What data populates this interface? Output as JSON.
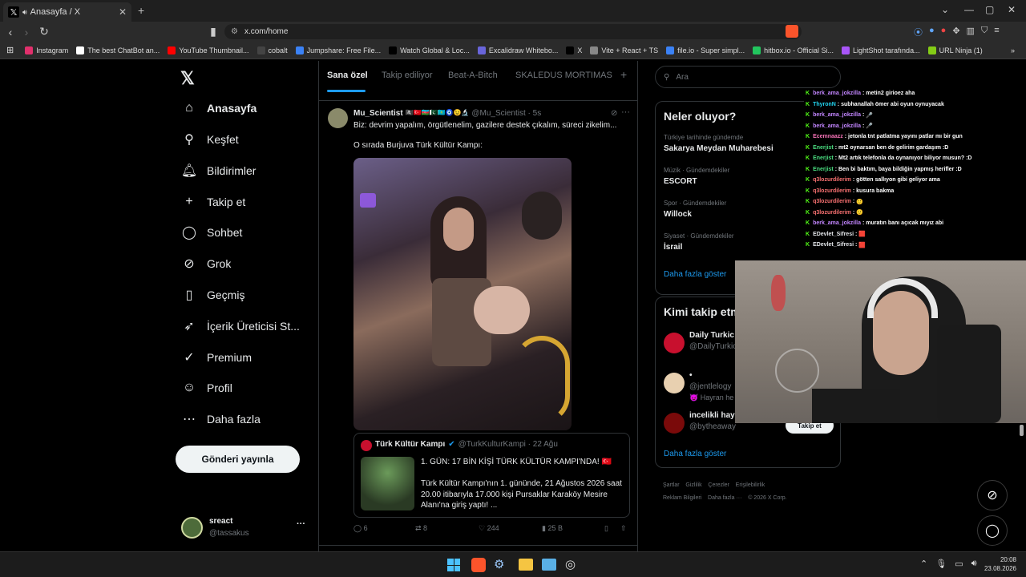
{
  "browser": {
    "tab_title": "Anasayfa / X",
    "url": "x.com/home",
    "bookmarks": [
      {
        "label": "Instagram",
        "color": "#e1306c"
      },
      {
        "label": "The best ChatBot an...",
        "color": "#ffffff"
      },
      {
        "label": "YouTube Thumbnail...",
        "color": "#ff0000"
      },
      {
        "label": "cobalt",
        "color": "#444444"
      },
      {
        "label": "Jumpshare: Free File...",
        "color": "#3b82f6"
      },
      {
        "label": "Watch Global & Loc...",
        "color": "#000000"
      },
      {
        "label": "Excalidraw Whitebo...",
        "color": "#6965db"
      },
      {
        "label": "X",
        "color": "#000000"
      },
      {
        "label": "Vite + React + TS",
        "color": "#888888"
      },
      {
        "label": "file.io - Super simpl...",
        "color": "#3b82f6"
      },
      {
        "label": "hitbox.io - Official Si...",
        "color": "#22c55e"
      },
      {
        "label": "LightShot tarafında...",
        "color": "#a855f7"
      },
      {
        "label": "URL Ninja (1)",
        "color": "#84cc16"
      }
    ]
  },
  "nav": {
    "items": [
      {
        "label": "Anasayfa",
        "icon": "home-icon",
        "glyph": "⌂"
      },
      {
        "label": "Keşfet",
        "icon": "search-icon",
        "glyph": "⚲"
      },
      {
        "label": "Bildirimler",
        "icon": "bell-icon",
        "glyph": "🔔︎"
      },
      {
        "label": "Takip et",
        "icon": "add-person-icon",
        "glyph": "+"
      },
      {
        "label": "Sohbet",
        "icon": "chat-icon",
        "glyph": "◯"
      },
      {
        "label": "Grok",
        "icon": "grok-icon",
        "glyph": "⊘"
      },
      {
        "label": "Geçmiş",
        "icon": "bookmark-icon",
        "glyph": "▯"
      },
      {
        "label": "İçerik Üreticisi St...",
        "icon": "rocket-icon",
        "glyph": "➶"
      },
      {
        "label": "Premium",
        "icon": "verified-icon",
        "glyph": "✓"
      },
      {
        "label": "Profil",
        "icon": "person-icon",
        "glyph": "☺"
      },
      {
        "label": "Daha fazla",
        "icon": "more-circle-icon",
        "glyph": "⋯"
      }
    ],
    "post_button": "Gönderi yayınla",
    "account": {
      "name": "sreact",
      "handle": "@tassakus",
      "more": "···"
    }
  },
  "feed": {
    "tabs": [
      "Sana özel",
      "Takip ediliyor",
      "Beat-A-Bitch",
      "SKALEDUS MORTIMAS"
    ],
    "add_tab": "+",
    "tweet": {
      "author": "Mu_Scientist",
      "emojis": "🏴‍☠️🇹🇷🇦🇿🇵🇰🇰🇿🧿😉🔬",
      "handle": "@Mu_Scientist · 5s",
      "text1": "Biz: devrim yapalım, örgütlenelim, gazilere destek çıkalım, süreci zikelim...",
      "text2": "O sırada Burjuva Türk Kültür Kampı:",
      "quote": {
        "name": "Türk Kültür Kampı",
        "handle": "@TurkKulturKampi · 22 Ağu",
        "headline": "1. GÜN: 17 BİN KİŞİ TÜRK KÜLTÜR KAMPI'NDA! 🇹🇷",
        "body": "Türk Kültür Kampı'nın 1. gününde, 21 Ağustos 2026 saat 20.00 itibarıyla 17.000 kişi Pursaklar Karaköy Mesire Alanı'na giriş yaptı! ..."
      },
      "stats": {
        "replies": "6",
        "reposts": "8",
        "likes": "244",
        "views": "25 B"
      }
    }
  },
  "right": {
    "search_placeholder": "Ara",
    "trends_title": "Neler oluyor?",
    "trends": [
      {
        "cat": "Türkiye tarihinde gündemde",
        "name": "Sakarya Meydan Muharebesi"
      },
      {
        "cat": "Müzik · Gündemdekiler",
        "name": "ESCORT"
      },
      {
        "cat": "Spor · Gündemdekiler",
        "name": "Willock"
      },
      {
        "cat": "Siyaset · Gündemdekiler",
        "name": "İsrail"
      }
    ],
    "trends_more": "Daha fazla göster",
    "follow_title": "Kimi takip etm",
    "follow": [
      {
        "name": "Daily Turkic",
        "handle": "@DailyTurkic",
        "extra": ""
      },
      {
        "name": "•",
        "handle": "@jentlelogy",
        "extra": "😈 Hayran he"
      },
      {
        "name": "incelikli hay",
        "handle": "@bytheaway",
        "extra": ""
      }
    ],
    "follow_button": "Takip et",
    "follow_more": "Daha fazla göster",
    "footer": [
      "Şartlar",
      "Gizlilik",
      "Çerezler",
      "Erişilebilirlik",
      "Reklam Bilgileri",
      "Daha fazla ···",
      "© 2026 X Corp."
    ]
  },
  "chat": [
    {
      "user": "berk_ama_jokzilla",
      "color": "#c084fc",
      "msg": "metin2 girioez aha"
    },
    {
      "user": "ThyronN",
      "color": "#22d3ee",
      "msg": "subhanallah ömer abi oyun oynuyacak"
    },
    {
      "user": "berk_ama_jokzilla",
      "color": "#c084fc",
      "msg": "🎤"
    },
    {
      "user": "berk_ama_jokzilla",
      "color": "#c084fc",
      "msg": "🎤"
    },
    {
      "user": "Ecemnaazz",
      "color": "#f472b6",
      "msg": "jetonla tnt patlatma yayını patlar mı bir gun"
    },
    {
      "user": "Enerjist",
      "color": "#4ade80",
      "msg": "mt2 oynarsan ben de gelirim gardaşım :D"
    },
    {
      "user": "Enerjist",
      "color": "#4ade80",
      "msg": "Mt2 artık telefonla da oynanıyor biliyor musun? :D"
    },
    {
      "user": "Enerjist",
      "color": "#4ade80",
      "msg": "Ben bi baktım, baya bildiğin yapmış herifler :D"
    },
    {
      "user": "q3lozurdilerim",
      "color": "#f87171",
      "msg": "götten sallıyon gibi geliyor ama"
    },
    {
      "user": "q3lozurdilerim",
      "color": "#f87171",
      "msg": "kusura bakma"
    },
    {
      "user": "q3lozurdilerim",
      "color": "#f87171",
      "msg": "🙂"
    },
    {
      "user": "q3lozurdilerim",
      "color": "#f87171",
      "msg": "🙂"
    },
    {
      "user": "berk_ama_jokzilla",
      "color": "#c084fc",
      "msg": "muratın banı açıcak mıyız abi"
    },
    {
      "user": "EDevlet_Sifresi",
      "color": "#e5e7eb",
      "msg": "🟥"
    },
    {
      "user": "EDevlet_Sifresi",
      "color": "#e5e7eb",
      "msg": "🟥"
    }
  ],
  "taskbar": {
    "time": "20:08",
    "date": "23.08.2026"
  }
}
